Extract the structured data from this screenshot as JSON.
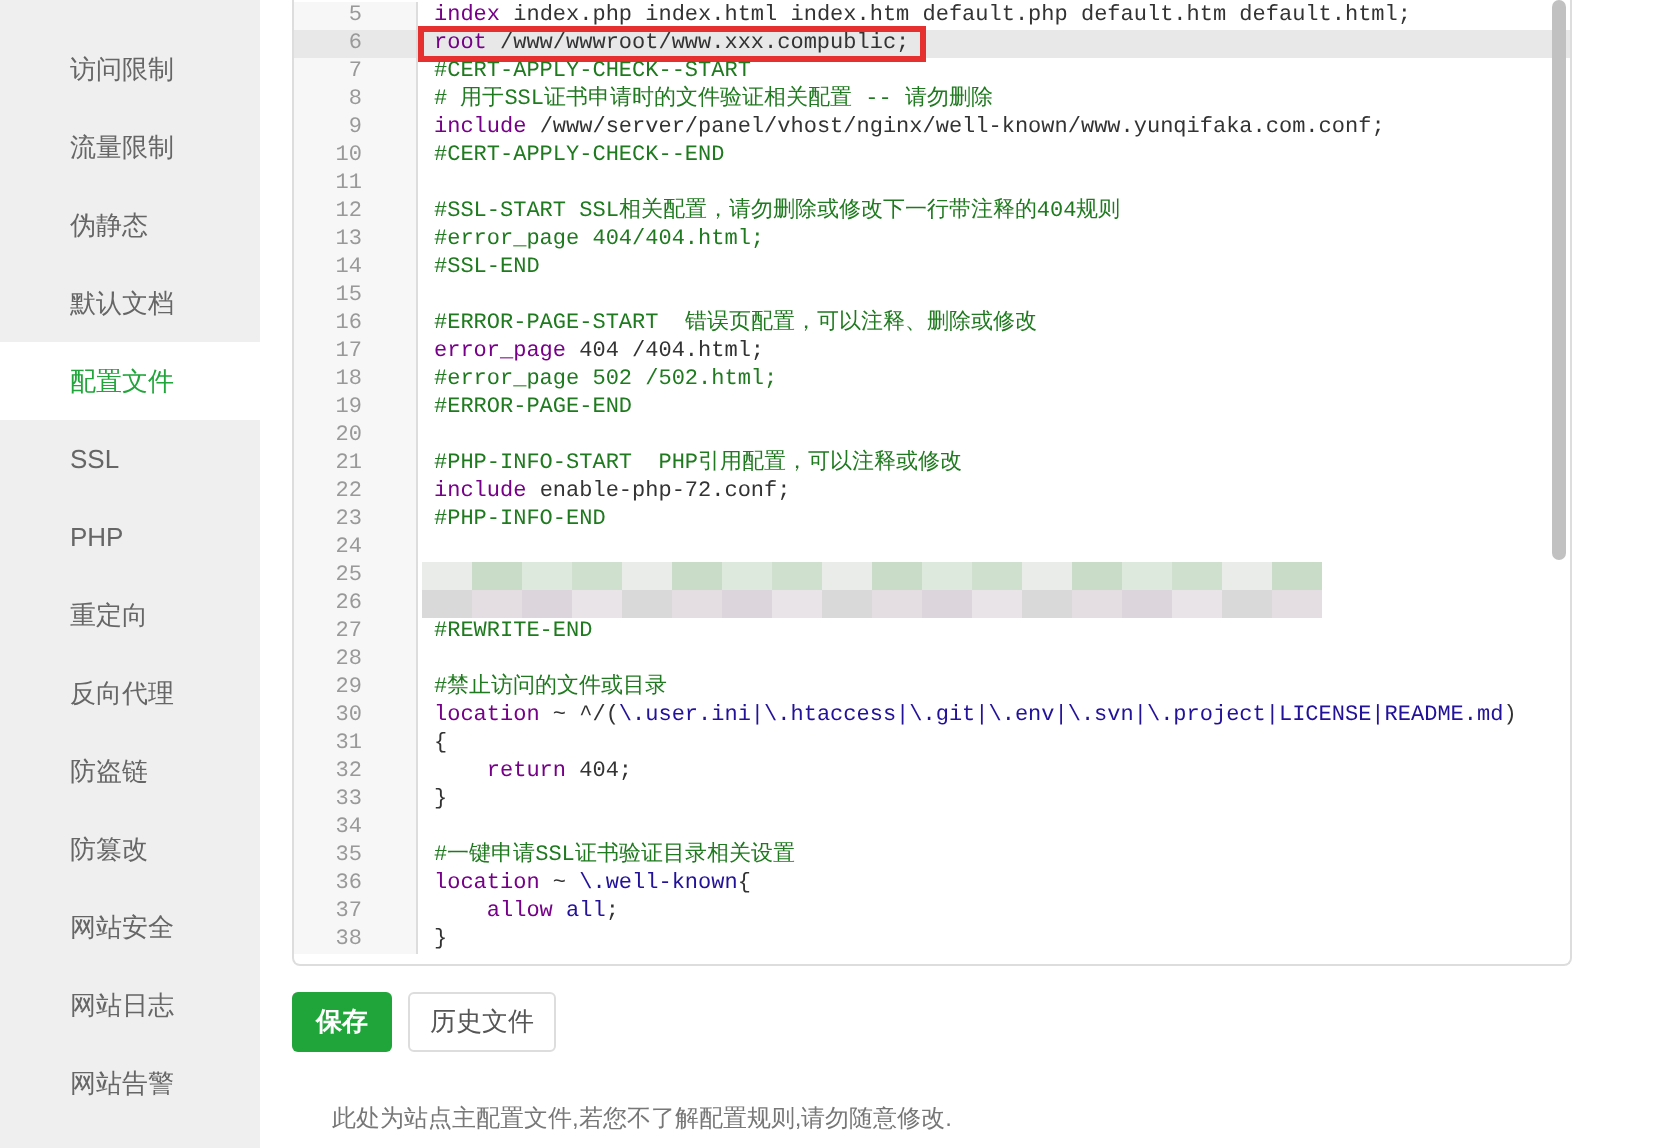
{
  "sidebar": {
    "items": [
      {
        "label": "访问限制",
        "selected": false
      },
      {
        "label": "流量限制",
        "selected": false
      },
      {
        "label": "伪静态",
        "selected": false
      },
      {
        "label": "默认文档",
        "selected": false
      },
      {
        "label": "配置文件",
        "selected": true
      },
      {
        "label": "SSL",
        "selected": false
      },
      {
        "label": "PHP",
        "selected": false
      },
      {
        "label": "重定向",
        "selected": false
      },
      {
        "label": "反向代理",
        "selected": false
      },
      {
        "label": "防盗链",
        "selected": false
      },
      {
        "label": "防篡改",
        "selected": false
      },
      {
        "label": "网站安全",
        "selected": false
      },
      {
        "label": "网站日志",
        "selected": false
      },
      {
        "label": "网站告警",
        "selected": false
      }
    ]
  },
  "editor": {
    "lines": [
      {
        "number": "5",
        "active": false,
        "boxed": false,
        "kind": "code",
        "tokens": [
          {
            "kind": "keyword",
            "text": "index"
          },
          {
            "kind": "plain",
            "text": " index.php index.html index.htm default.php default.htm default.html;"
          }
        ]
      },
      {
        "number": "6",
        "active": true,
        "boxed": true,
        "kind": "code",
        "tokens": [
          {
            "kind": "keyword",
            "text": "root"
          },
          {
            "kind": "plain",
            "text": " /www/wwwroot/www.xxx.compublic;"
          }
        ]
      },
      {
        "number": "7",
        "active": false,
        "boxed": false,
        "kind": "code",
        "tokens": [
          {
            "kind": "comment",
            "text": "#CERT-APPLY-CHECK--START"
          }
        ]
      },
      {
        "number": "8",
        "active": false,
        "boxed": false,
        "kind": "code",
        "tokens": [
          {
            "kind": "comment",
            "text": "# 用于SSL证书申请时的文件验证相关配置 -- 请勿删除"
          }
        ]
      },
      {
        "number": "9",
        "active": false,
        "boxed": false,
        "kind": "code",
        "tokens": [
          {
            "kind": "keyword",
            "text": "include"
          },
          {
            "kind": "plain",
            "text": " /www/server/panel/vhost/nginx/well-known/www.yunqifaka.com.conf;"
          }
        ]
      },
      {
        "number": "10",
        "active": false,
        "boxed": false,
        "kind": "code",
        "tokens": [
          {
            "kind": "comment",
            "text": "#CERT-APPLY-CHECK--END"
          }
        ]
      },
      {
        "number": "11",
        "active": false,
        "boxed": false,
        "kind": "code"
      },
      {
        "number": "12",
        "active": false,
        "boxed": false,
        "kind": "code",
        "tokens": [
          {
            "kind": "comment",
            "text": "#SSL-START SSL相关配置，请勿删除或修改下一行带注释的404规则"
          }
        ]
      },
      {
        "number": "13",
        "active": false,
        "boxed": false,
        "kind": "code",
        "tokens": [
          {
            "kind": "comment",
            "text": "#error_page 404/404.html;"
          }
        ]
      },
      {
        "number": "14",
        "active": false,
        "boxed": false,
        "kind": "code",
        "tokens": [
          {
            "kind": "comment",
            "text": "#SSL-END"
          }
        ]
      },
      {
        "number": "15",
        "active": false,
        "boxed": false,
        "kind": "code"
      },
      {
        "number": "16",
        "active": false,
        "boxed": false,
        "kind": "code",
        "tokens": [
          {
            "kind": "comment",
            "text": "#ERROR-PAGE-START  错误页配置，可以注释、删除或修改"
          }
        ]
      },
      {
        "number": "17",
        "active": false,
        "boxed": false,
        "kind": "code",
        "tokens": [
          {
            "kind": "keyword",
            "text": "error_page"
          },
          {
            "kind": "plain",
            "text": " 404 /404.html;"
          }
        ]
      },
      {
        "number": "18",
        "active": false,
        "boxed": false,
        "kind": "code",
        "tokens": [
          {
            "kind": "comment",
            "text": "#error_page 502 /502.html;"
          }
        ]
      },
      {
        "number": "19",
        "active": false,
        "boxed": false,
        "kind": "code",
        "tokens": [
          {
            "kind": "comment",
            "text": "#ERROR-PAGE-END"
          }
        ]
      },
      {
        "number": "20",
        "active": false,
        "boxed": false,
        "kind": "code"
      },
      {
        "number": "21",
        "active": false,
        "boxed": false,
        "kind": "code",
        "tokens": [
          {
            "kind": "comment",
            "text": "#PHP-INFO-START  PHP引用配置，可以注释或修改"
          }
        ]
      },
      {
        "number": "22",
        "active": false,
        "boxed": false,
        "kind": "code",
        "tokens": [
          {
            "kind": "keyword",
            "text": "include"
          },
          {
            "kind": "plain",
            "text": " enable-php-72.conf;"
          }
        ]
      },
      {
        "number": "23",
        "active": false,
        "boxed": false,
        "kind": "code",
        "tokens": [
          {
            "kind": "comment",
            "text": "#PHP-INFO-END"
          }
        ]
      },
      {
        "number": "24",
        "active": false,
        "boxed": false,
        "kind": "code"
      },
      {
        "number": "25",
        "active": false,
        "boxed": false,
        "kind": "blurred"
      },
      {
        "number": "26",
        "active": false,
        "boxed": false,
        "kind": "blurred"
      },
      {
        "number": "27",
        "active": false,
        "boxed": false,
        "kind": "code",
        "tokens": [
          {
            "kind": "comment",
            "text": "#REWRITE-END"
          }
        ]
      },
      {
        "number": "28",
        "active": false,
        "boxed": false,
        "kind": "code"
      },
      {
        "number": "29",
        "active": false,
        "boxed": false,
        "kind": "code",
        "tokens": [
          {
            "kind": "comment",
            "text": "#禁止访问的文件或目录"
          }
        ]
      },
      {
        "number": "30",
        "active": false,
        "boxed": false,
        "kind": "code",
        "tokens": [
          {
            "kind": "keyword",
            "text": "location"
          },
          {
            "kind": "plain",
            "text": " ~ ^/("
          },
          {
            "kind": "atom",
            "text": "\\.user.ini|\\.htaccess|\\.git|\\.env|\\.svn|\\.project|LICENSE|README.md"
          },
          {
            "kind": "plain",
            "text": ")"
          }
        ]
      },
      {
        "number": "31",
        "active": false,
        "boxed": false,
        "kind": "code",
        "tokens": [
          {
            "kind": "plain",
            "text": "{"
          }
        ]
      },
      {
        "number": "32",
        "active": false,
        "boxed": false,
        "kind": "code",
        "tokens": [
          {
            "kind": "keyword",
            "text": "    return"
          },
          {
            "kind": "plain",
            "text": " 404;"
          }
        ]
      },
      {
        "number": "33",
        "active": false,
        "boxed": false,
        "kind": "code",
        "tokens": [
          {
            "kind": "plain",
            "text": "}"
          }
        ]
      },
      {
        "number": "34",
        "active": false,
        "boxed": false,
        "kind": "code"
      },
      {
        "number": "35",
        "active": false,
        "boxed": false,
        "kind": "code",
        "tokens": [
          {
            "kind": "comment",
            "text": "#一键申请SSL证书验证目录相关设置"
          }
        ]
      },
      {
        "number": "36",
        "active": false,
        "boxed": false,
        "kind": "code",
        "tokens": [
          {
            "kind": "keyword",
            "text": "location"
          },
          {
            "kind": "plain",
            "text": " ~ "
          },
          {
            "kind": "atom",
            "text": "\\.well-known"
          },
          {
            "kind": "plain",
            "text": "{"
          }
        ]
      },
      {
        "number": "37",
        "active": false,
        "boxed": false,
        "kind": "code",
        "tokens": [
          {
            "kind": "keyword",
            "text": "    allow "
          },
          {
            "kind": "atom",
            "text": "all"
          },
          {
            "kind": "plain",
            "text": ";"
          }
        ]
      },
      {
        "number": "38",
        "active": false,
        "boxed": false,
        "kind": "code",
        "tokens": [
          {
            "kind": "plain",
            "text": "}"
          }
        ]
      }
    ]
  },
  "buttons": [
    {
      "label": "保存",
      "kind": "primary"
    },
    {
      "label": "历史文件",
      "kind": "secondary"
    }
  ],
  "note": "此处为站点主配置文件,若您不了解配置规则,请勿随意修改."
}
